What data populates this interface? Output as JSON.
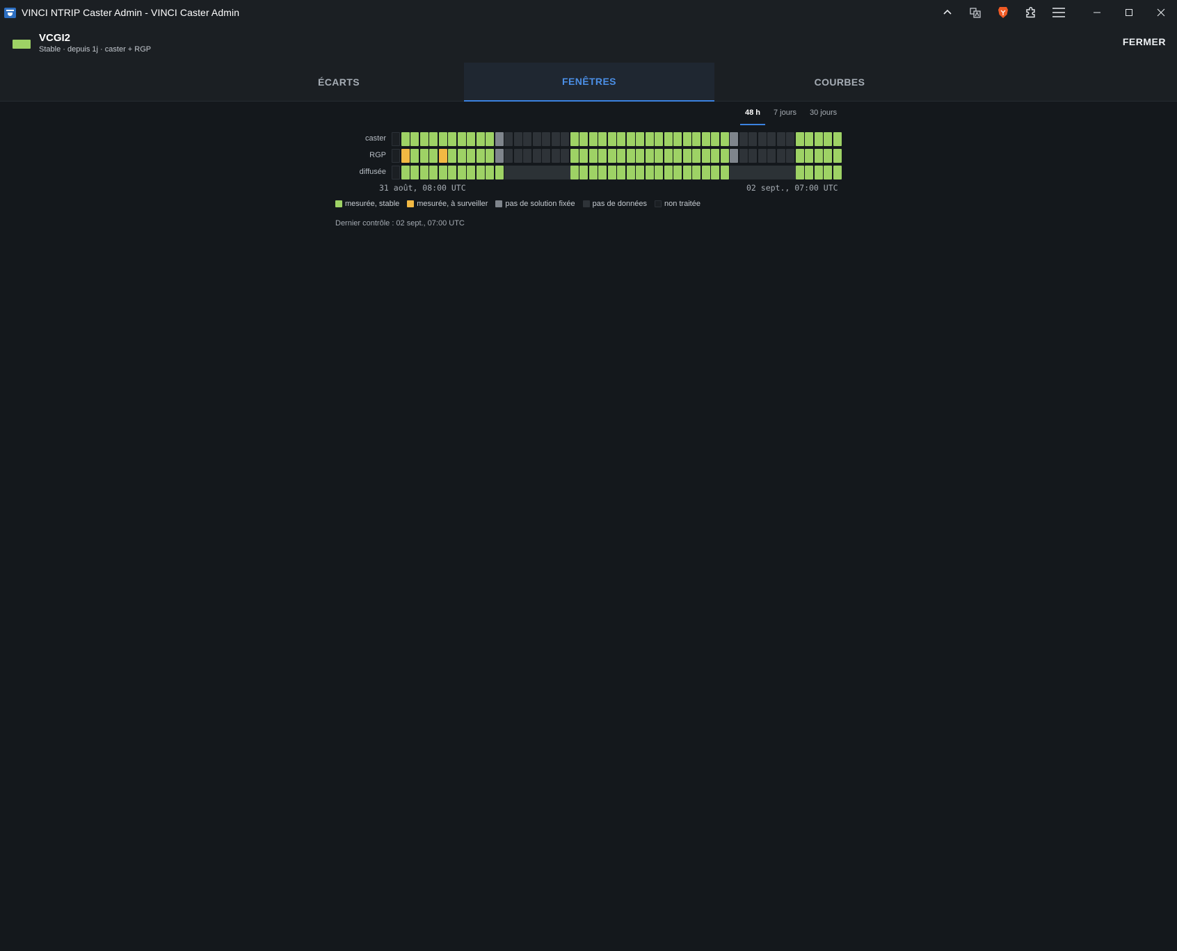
{
  "window": {
    "title": "VINCI NTRIP Caster Admin - VINCI Caster Admin",
    "toolbar_icons": [
      "chevron-up-icon",
      "translate-icon",
      "brave-lion-icon",
      "puzzle-icon",
      "menu-icon"
    ],
    "controls": [
      "minimize-icon",
      "maximize-icon",
      "close-icon"
    ]
  },
  "station": {
    "name": "VCGI2",
    "subtitle": "Stable · depuis 1j · caster + RGP",
    "status_color": "#9ed265"
  },
  "close_label": "FERMER",
  "tabs": [
    {
      "label": "ÉCARTS",
      "active": false
    },
    {
      "label": "FENÊTRES",
      "active": true
    },
    {
      "label": "COURBES",
      "active": false
    }
  ],
  "ranges": [
    {
      "label": "48 h",
      "active": true
    },
    {
      "label": "7 jours",
      "active": false
    },
    {
      "label": "30 jours",
      "active": false
    }
  ],
  "timeline": {
    "rows": [
      {
        "label": "caster",
        "states": "uSSSSSSSSSSFDDDDDDDSSSSSSSSSSSSSSSSSFDDDDDDSSSSS"
      },
      {
        "label": "RGP",
        "states": "uWSSSWSSSSSFDDDDDDDSSSSSSSSSSSSSSSSSFDDDDDDSSSSS"
      },
      {
        "label": "diffusée",
        "states": "uSSSSSSSSSSSBBBBBBBSSSSSSSSSSSSSSSSSBBBBBBBSSSSS"
      }
    ],
    "start_label": "31 août, 08:00 UTC",
    "end_label": "02 sept., 07:00 UTC"
  },
  "legend": [
    {
      "label": "mesurée, stable",
      "color": "#9ed265"
    },
    {
      "label": "mesurée, à surveiller",
      "color": "#f2b943"
    },
    {
      "label": "pas de solution fixée",
      "color": "#7f858c"
    },
    {
      "label": "pas de données",
      "color": "#2e3338"
    },
    {
      "label": "non traitée",
      "color": "#1b1f23"
    }
  ],
  "last_check": "Dernier contrôle : 02 sept., 07:00 UTC",
  "colors": {
    "accent": "#3b82e0",
    "stable": "#9ed265",
    "watch": "#f2b943",
    "nofix": "#7f858c",
    "nodata": "#2e3338"
  }
}
